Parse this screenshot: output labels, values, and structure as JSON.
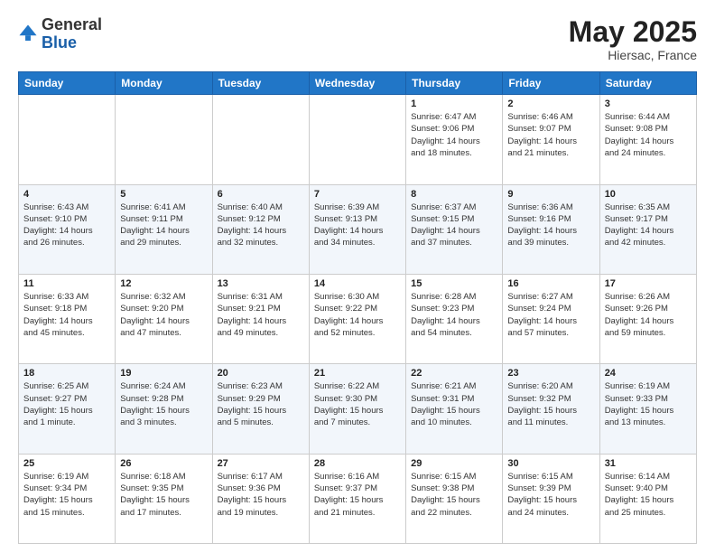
{
  "header": {
    "logo_general": "General",
    "logo_blue": "Blue",
    "title": "May 2025",
    "location": "Hiersac, France"
  },
  "weekdays": [
    "Sunday",
    "Monday",
    "Tuesday",
    "Wednesday",
    "Thursday",
    "Friday",
    "Saturday"
  ],
  "weeks": [
    [
      {
        "day": "",
        "info": ""
      },
      {
        "day": "",
        "info": ""
      },
      {
        "day": "",
        "info": ""
      },
      {
        "day": "",
        "info": ""
      },
      {
        "day": "1",
        "info": "Sunrise: 6:47 AM\nSunset: 9:06 PM\nDaylight: 14 hours\nand 18 minutes."
      },
      {
        "day": "2",
        "info": "Sunrise: 6:46 AM\nSunset: 9:07 PM\nDaylight: 14 hours\nand 21 minutes."
      },
      {
        "day": "3",
        "info": "Sunrise: 6:44 AM\nSunset: 9:08 PM\nDaylight: 14 hours\nand 24 minutes."
      }
    ],
    [
      {
        "day": "4",
        "info": "Sunrise: 6:43 AM\nSunset: 9:10 PM\nDaylight: 14 hours\nand 26 minutes."
      },
      {
        "day": "5",
        "info": "Sunrise: 6:41 AM\nSunset: 9:11 PM\nDaylight: 14 hours\nand 29 minutes."
      },
      {
        "day": "6",
        "info": "Sunrise: 6:40 AM\nSunset: 9:12 PM\nDaylight: 14 hours\nand 32 minutes."
      },
      {
        "day": "7",
        "info": "Sunrise: 6:39 AM\nSunset: 9:13 PM\nDaylight: 14 hours\nand 34 minutes."
      },
      {
        "day": "8",
        "info": "Sunrise: 6:37 AM\nSunset: 9:15 PM\nDaylight: 14 hours\nand 37 minutes."
      },
      {
        "day": "9",
        "info": "Sunrise: 6:36 AM\nSunset: 9:16 PM\nDaylight: 14 hours\nand 39 minutes."
      },
      {
        "day": "10",
        "info": "Sunrise: 6:35 AM\nSunset: 9:17 PM\nDaylight: 14 hours\nand 42 minutes."
      }
    ],
    [
      {
        "day": "11",
        "info": "Sunrise: 6:33 AM\nSunset: 9:18 PM\nDaylight: 14 hours\nand 45 minutes."
      },
      {
        "day": "12",
        "info": "Sunrise: 6:32 AM\nSunset: 9:20 PM\nDaylight: 14 hours\nand 47 minutes."
      },
      {
        "day": "13",
        "info": "Sunrise: 6:31 AM\nSunset: 9:21 PM\nDaylight: 14 hours\nand 49 minutes."
      },
      {
        "day": "14",
        "info": "Sunrise: 6:30 AM\nSunset: 9:22 PM\nDaylight: 14 hours\nand 52 minutes."
      },
      {
        "day": "15",
        "info": "Sunrise: 6:28 AM\nSunset: 9:23 PM\nDaylight: 14 hours\nand 54 minutes."
      },
      {
        "day": "16",
        "info": "Sunrise: 6:27 AM\nSunset: 9:24 PM\nDaylight: 14 hours\nand 57 minutes."
      },
      {
        "day": "17",
        "info": "Sunrise: 6:26 AM\nSunset: 9:26 PM\nDaylight: 14 hours\nand 59 minutes."
      }
    ],
    [
      {
        "day": "18",
        "info": "Sunrise: 6:25 AM\nSunset: 9:27 PM\nDaylight: 15 hours\nand 1 minute."
      },
      {
        "day": "19",
        "info": "Sunrise: 6:24 AM\nSunset: 9:28 PM\nDaylight: 15 hours\nand 3 minutes."
      },
      {
        "day": "20",
        "info": "Sunrise: 6:23 AM\nSunset: 9:29 PM\nDaylight: 15 hours\nand 5 minutes."
      },
      {
        "day": "21",
        "info": "Sunrise: 6:22 AM\nSunset: 9:30 PM\nDaylight: 15 hours\nand 7 minutes."
      },
      {
        "day": "22",
        "info": "Sunrise: 6:21 AM\nSunset: 9:31 PM\nDaylight: 15 hours\nand 10 minutes."
      },
      {
        "day": "23",
        "info": "Sunrise: 6:20 AM\nSunset: 9:32 PM\nDaylight: 15 hours\nand 11 minutes."
      },
      {
        "day": "24",
        "info": "Sunrise: 6:19 AM\nSunset: 9:33 PM\nDaylight: 15 hours\nand 13 minutes."
      }
    ],
    [
      {
        "day": "25",
        "info": "Sunrise: 6:19 AM\nSunset: 9:34 PM\nDaylight: 15 hours\nand 15 minutes."
      },
      {
        "day": "26",
        "info": "Sunrise: 6:18 AM\nSunset: 9:35 PM\nDaylight: 15 hours\nand 17 minutes."
      },
      {
        "day": "27",
        "info": "Sunrise: 6:17 AM\nSunset: 9:36 PM\nDaylight: 15 hours\nand 19 minutes."
      },
      {
        "day": "28",
        "info": "Sunrise: 6:16 AM\nSunset: 9:37 PM\nDaylight: 15 hours\nand 21 minutes."
      },
      {
        "day": "29",
        "info": "Sunrise: 6:15 AM\nSunset: 9:38 PM\nDaylight: 15 hours\nand 22 minutes."
      },
      {
        "day": "30",
        "info": "Sunrise: 6:15 AM\nSunset: 9:39 PM\nDaylight: 15 hours\nand 24 minutes."
      },
      {
        "day": "31",
        "info": "Sunrise: 6:14 AM\nSunset: 9:40 PM\nDaylight: 15 hours\nand 25 minutes."
      }
    ]
  ]
}
